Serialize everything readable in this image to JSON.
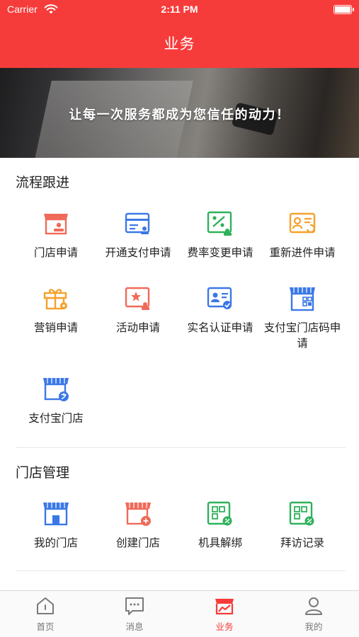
{
  "status_bar": {
    "carrier": "Carrier",
    "time": "2:11 PM"
  },
  "header": {
    "title": "业务"
  },
  "banner": {
    "slogan": "让每一次服务都成为您信任的动力！"
  },
  "sections": [
    {
      "title": "流程跟进",
      "items": [
        {
          "label": "门店申请",
          "icon": "store-apply-icon"
        },
        {
          "label": "开通支付申请",
          "icon": "payment-card-icon"
        },
        {
          "label": "费率变更申请",
          "icon": "rate-change-icon"
        },
        {
          "label": "重新进件申请",
          "icon": "reapply-icon"
        },
        {
          "label": "营销申请",
          "icon": "gift-icon"
        },
        {
          "label": "活动申请",
          "icon": "activity-star-icon"
        },
        {
          "label": "实名认证申请",
          "icon": "id-verify-icon"
        },
        {
          "label": "支付宝门店码申请",
          "icon": "store-qrcode-icon"
        },
        {
          "label": "支付宝门店",
          "icon": "alipay-store-icon"
        }
      ]
    },
    {
      "title": "门店管理",
      "items": [
        {
          "label": "我的门店",
          "icon": "my-store-icon"
        },
        {
          "label": "创建门店",
          "icon": "create-store-icon"
        },
        {
          "label": "机具解绑",
          "icon": "device-unbind-icon"
        },
        {
          "label": "拜访记录",
          "icon": "visit-record-icon"
        }
      ]
    }
  ],
  "tabbar": {
    "items": [
      {
        "label": "首页",
        "icon": "home-icon",
        "active": false
      },
      {
        "label": "消息",
        "icon": "message-icon",
        "active": false
      },
      {
        "label": "业务",
        "icon": "business-icon",
        "active": true
      },
      {
        "label": "我的",
        "icon": "profile-icon",
        "active": false
      }
    ]
  },
  "colors": {
    "brand_red": "#f63c3a",
    "blue": "#3b78e7",
    "green": "#2fb15a",
    "orange": "#f5a12b",
    "tab_inactive": "#7a7a7a"
  }
}
